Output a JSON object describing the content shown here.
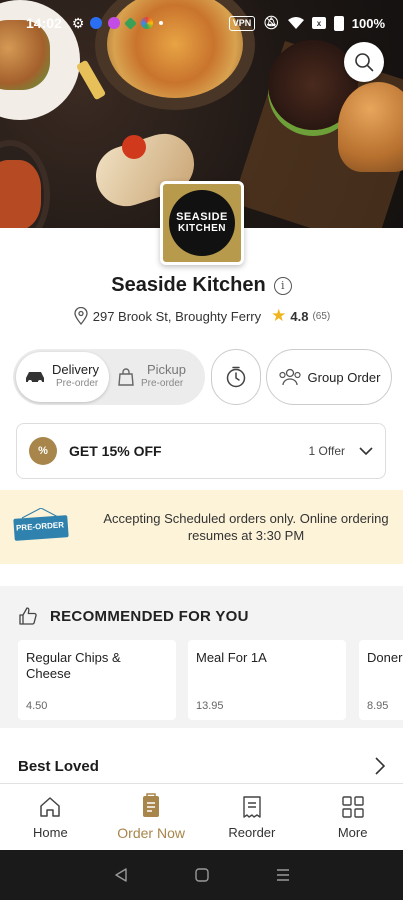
{
  "status_bar": {
    "time": "14:02",
    "vpn": "VPN",
    "battery": "100%"
  },
  "restaurant": {
    "name": "Seaside Kitchen",
    "logo_line1": "SEASIDE",
    "logo_line2": "KITCHEN",
    "address": "297 Brook St, Broughty Ferry",
    "rating": "4.8",
    "rating_count": "(65)"
  },
  "order_modes": {
    "delivery": {
      "label": "Delivery",
      "sub": "Pre-order"
    },
    "pickup": {
      "label": "Pickup",
      "sub": "Pre-order"
    },
    "group_order": "Group Order"
  },
  "offer": {
    "badge": "%",
    "title": "GET 15% OFF",
    "count": "1 Offer"
  },
  "notice": {
    "tag": "PRE-ORDER",
    "text": "Accepting Scheduled orders only. Online ordering resumes at 3:30 PM"
  },
  "recommended": {
    "title": "RECOMMENDED FOR YOU",
    "items": [
      {
        "name": "Regular Chips & Cheese",
        "price": "4.50"
      },
      {
        "name": "Meal For 1A",
        "price": "13.95"
      },
      {
        "name": "Doner",
        "price": "8.95"
      }
    ]
  },
  "best_loved": {
    "title": "Best Loved"
  },
  "bottom_nav": [
    {
      "label": "Home"
    },
    {
      "label": "Order Now"
    },
    {
      "label": "Reorder"
    },
    {
      "label": "More"
    }
  ],
  "colors": {
    "accent": "#a8854a",
    "notice_bg": "#fcf3d9",
    "star": "#f0b41c"
  }
}
